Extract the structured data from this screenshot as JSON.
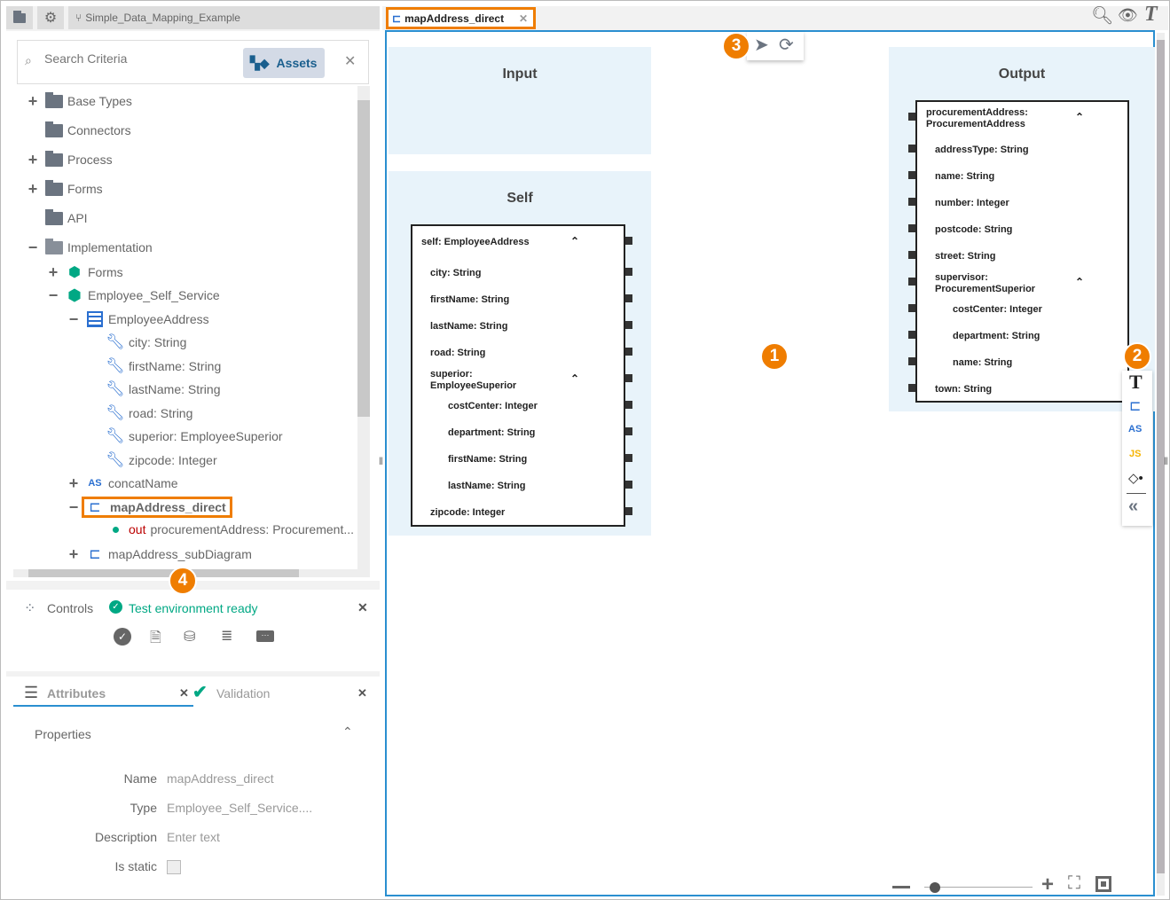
{
  "project_tab": "Simple_Data_Mapping_Example",
  "search": {
    "placeholder": "Search Criteria",
    "assets_label": "Assets"
  },
  "tree": [
    {
      "level": 0,
      "toggle": "+",
      "icon": "folder",
      "label": "Base Types"
    },
    {
      "level": 0,
      "toggle": "",
      "icon": "folder",
      "label": "Connectors"
    },
    {
      "level": 0,
      "toggle": "+",
      "icon": "folder",
      "label": "Process"
    },
    {
      "level": 0,
      "toggle": "+",
      "icon": "folder",
      "label": "Forms"
    },
    {
      "level": 0,
      "toggle": "",
      "icon": "folder",
      "label": "API"
    },
    {
      "level": 0,
      "toggle": "−",
      "icon": "folder-open",
      "label": "Implementation"
    },
    {
      "level": 1,
      "toggle": "+",
      "icon": "locked-package",
      "label": "Forms"
    },
    {
      "level": 1,
      "toggle": "−",
      "icon": "package",
      "label": "Employee_Self_Service"
    },
    {
      "level": 2,
      "toggle": "−",
      "icon": "data-type",
      "label": "EmployeeAddress"
    },
    {
      "level": 3,
      "toggle": "",
      "icon": "wrench",
      "label": "city: String"
    },
    {
      "level": 3,
      "toggle": "",
      "icon": "wrench",
      "label": "firstName: String"
    },
    {
      "level": 3,
      "toggle": "",
      "icon": "wrench",
      "label": "lastName: String"
    },
    {
      "level": 3,
      "toggle": "",
      "icon": "wrench",
      "label": "road: String"
    },
    {
      "level": 3,
      "toggle": "",
      "icon": "wrench",
      "label": "superior: EmployeeSuperior"
    },
    {
      "level": 3,
      "toggle": "",
      "icon": "wrench",
      "label": "zipcode: Integer"
    },
    {
      "level": 2,
      "toggle": "+",
      "icon": "as",
      "label": "concatName"
    },
    {
      "level": 2,
      "toggle": "−",
      "icon": "mapping",
      "label": "mapAddress_direct",
      "selected": true
    },
    {
      "level": 3,
      "toggle": "",
      "icon": "dot",
      "prefix": "out",
      "label": "procurementAddress: Procurement..."
    },
    {
      "level": 2,
      "toggle": "+",
      "icon": "mapping",
      "label": "mapAddress_subDiagram"
    }
  ],
  "controls": {
    "label": "Controls",
    "status": "Test environment ready"
  },
  "attributes": {
    "tab": "Attributes",
    "validation_tab": "Validation",
    "section": "Properties",
    "fields": [
      {
        "label": "Name",
        "value": "mapAddress_direct"
      },
      {
        "label": "Type",
        "value": "Employee_Self_Service...."
      },
      {
        "label": "Description",
        "value": "Enter text"
      },
      {
        "label": "Is static",
        "value": ""
      }
    ]
  },
  "editor_tab": "mapAddress_direct",
  "canvas": {
    "input_title": "Input",
    "self_title": "Self",
    "output_title": "Output",
    "self_items": [
      {
        "text": "self: EmployeeAddress",
        "indent": 0,
        "caret": true
      },
      {
        "text": "city: String",
        "indent": 1
      },
      {
        "text": "firstName: String",
        "indent": 1
      },
      {
        "text": "lastName: String",
        "indent": 1
      },
      {
        "text": "road: String",
        "indent": 1
      },
      {
        "text": "superior:\nEmployeeSuperior",
        "indent": 1,
        "caret": true
      },
      {
        "text": "costCenter: Integer",
        "indent": 2
      },
      {
        "text": "department: String",
        "indent": 2
      },
      {
        "text": "firstName: String",
        "indent": 2
      },
      {
        "text": "lastName: String",
        "indent": 2
      },
      {
        "text": "zipcode: Integer",
        "indent": 1
      }
    ],
    "output_items": [
      {
        "text": "procurementAddress:\nProcurementAddress",
        "indent": 0,
        "caret": true
      },
      {
        "text": "addressType: String",
        "indent": 1
      },
      {
        "text": "name: String",
        "indent": 1
      },
      {
        "text": "number: Integer",
        "indent": 1
      },
      {
        "text": "postcode: String",
        "indent": 1
      },
      {
        "text": "street: String",
        "indent": 1
      },
      {
        "text": "supervisor:\nProcurementSuperior",
        "indent": 1,
        "caret": true
      },
      {
        "text": "costCenter: Integer",
        "indent": 2
      },
      {
        "text": "department: String",
        "indent": 2
      },
      {
        "text": "name: String",
        "indent": 2
      },
      {
        "text": "town: String",
        "indent": 1
      }
    ]
  },
  "badges": [
    "1",
    "2",
    "3",
    "4"
  ],
  "zoom_level": 0.1,
  "colors": {
    "accent": "#2a8fd0",
    "highlight": "#ef7d00",
    "ok": "#00a884",
    "zone": "#e8f3fa"
  }
}
